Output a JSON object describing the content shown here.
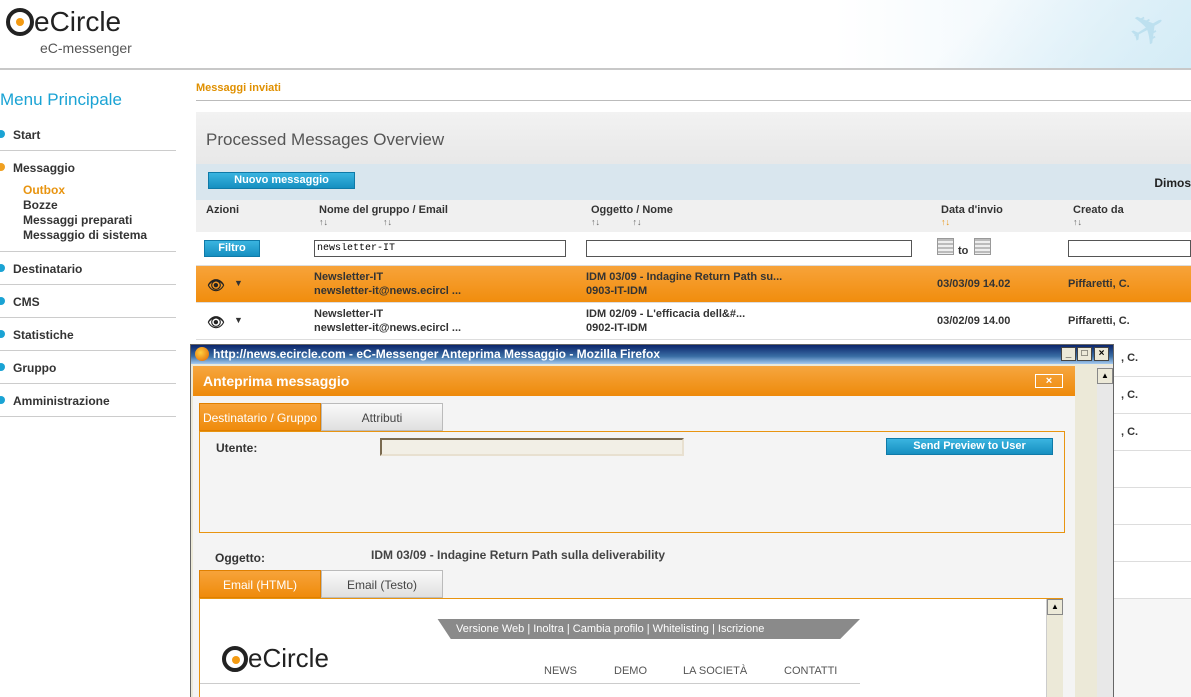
{
  "header": {
    "logo_text": "eCircle",
    "logo_sub": "eC-messenger"
  },
  "sidebar": {
    "title": "Menu Principale",
    "items": [
      {
        "label": "Start"
      },
      {
        "label": "Messaggio",
        "sub": [
          "Outbox",
          "Bozze",
          "Messaggi preparati",
          "Messaggio di sistema"
        ]
      },
      {
        "label": "Destinatario"
      },
      {
        "label": "CMS"
      },
      {
        "label": "Statistiche"
      },
      {
        "label": "Gruppo"
      },
      {
        "label": "Amministrazione"
      }
    ]
  },
  "breadcrumb": "Messaggi inviati",
  "panel": {
    "title": "Processed Messages Overview",
    "new_button": "Nuovo messaggio",
    "dimos": "Dimos",
    "columns": {
      "azioni": "Azioni",
      "gruppo": "Nome del gruppo",
      "email": "Email",
      "oggetto": "Oggetto",
      "nome": "Nome",
      "data": "Data d'invio",
      "creato": "Creato da",
      "slash": "/"
    },
    "sort_glyph": "↑↓",
    "filter_button": "Filtro",
    "filter_gruppo_value": "newsletter-IT",
    "to_label": "to",
    "rows": [
      {
        "group": "Newsletter-IT",
        "email": "newsletter-it@news.ecircl ...",
        "subject": "IDM 03/09 - Indagine Return Path su...",
        "name": "0903-IT-IDM",
        "date": "03/03/09 14.02",
        "creator": "Piffaretti, C."
      },
      {
        "group": "Newsletter-IT",
        "email": "newsletter-it@news.ecircl ...",
        "subject": "IDM 02/09 - L'efficacia dell&#...",
        "name": "0902-IT-IDM",
        "date": "03/02/09 14.00",
        "creator": "Piffaretti, C."
      }
    ],
    "tail_text": ", C."
  },
  "popup": {
    "window_title": "http://news.ecircle.com - eC-Messenger Anteprima Messaggio - Mozilla Firefox",
    "header": "Anteprima messaggio",
    "tabs1": [
      "Destinatario / Gruppo",
      "Attributi"
    ],
    "utente_label": "Utente:",
    "send_button": "Send Preview to User",
    "oggetto_label": "Oggetto:",
    "oggetto_value": "IDM 03/09 - Indagine Return Path sulla deliverability",
    "tabs2": [
      "Email (HTML)",
      "Email (Testo)"
    ],
    "email_topbar": "Versione Web  |  Inoltra  |  Cambia profilo  |  Whitelisting  |  Iscrizione",
    "email_logo": "eCircle",
    "email_nav": [
      "NEWS",
      "DEMO",
      "LA SOCIETÀ",
      "CONTATTI"
    ],
    "win_buttons": [
      "_",
      "□",
      "×"
    ],
    "close_glyph": "×",
    "scroll_up": "▲"
  }
}
